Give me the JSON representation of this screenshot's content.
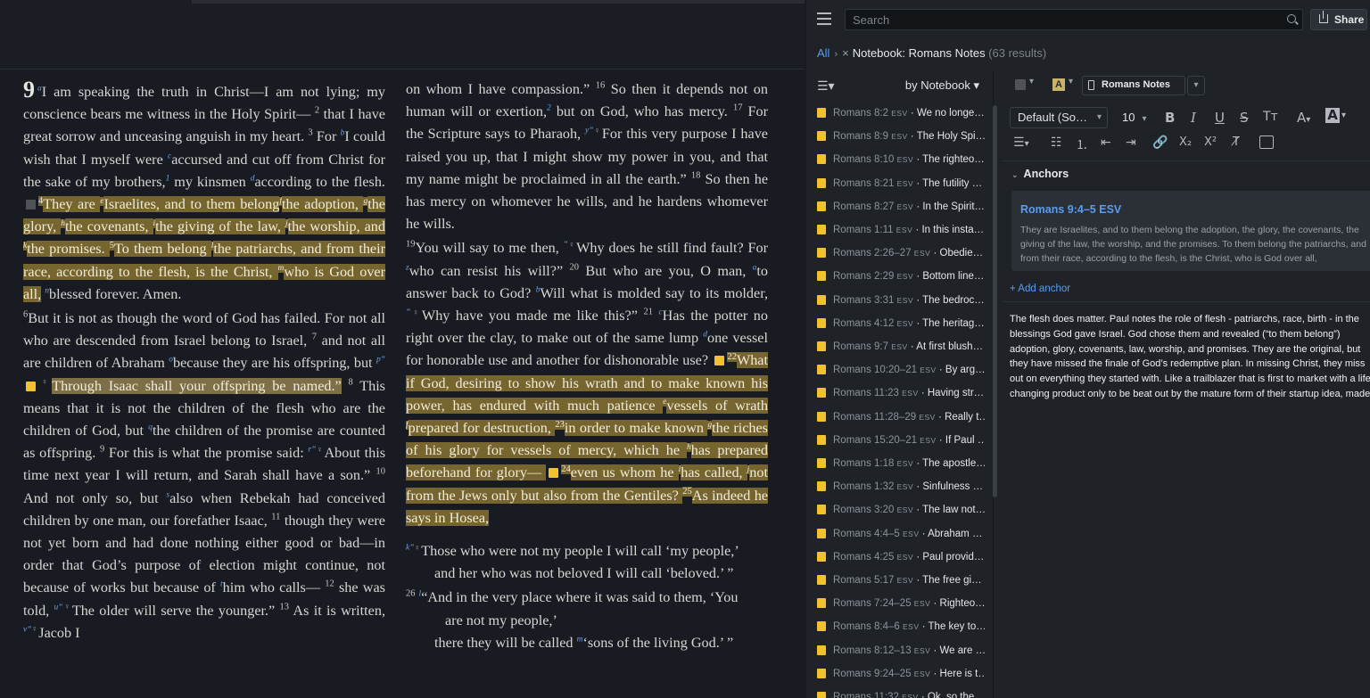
{
  "bible": {
    "col1": [
      {
        "parts": [
          {
            "t": "9",
            "c": "chap"
          },
          {
            "t": "a",
            "c": "xr"
          },
          {
            "t": "I am speaking the truth in Christ—I am not lying; my conscience bears me witness in the Holy Spirit— "
          },
          {
            "t": "2",
            "c": "vn"
          },
          {
            "t": " that I have great sorrow and unceasing anguish in my heart. "
          },
          {
            "t": "3",
            "c": "vn"
          },
          {
            "t": " For "
          },
          {
            "t": "b",
            "c": "xr"
          },
          {
            "t": "I could wish that I myself were "
          },
          {
            "t": "c",
            "c": "xr"
          },
          {
            "t": "accursed and cut off from Christ for the sake of my brothers,"
          },
          {
            "t": "1",
            "c": "xr"
          },
          {
            "t": " my kinsmen "
          },
          {
            "t": "d",
            "c": "xr"
          },
          {
            "t": "according to the flesh. "
          },
          {
            "c": "noteg"
          },
          {
            "t": "4",
            "c": "vn hl"
          },
          {
            "t": "They are ",
            "c": "hl"
          },
          {
            "t": "e",
            "c": "xr hl"
          },
          {
            "t": "Israelites, and to them belong",
            "c": "hl"
          },
          {
            "t": "f",
            "c": "xr hl"
          },
          {
            "t": "the adoption, ",
            "c": "hl"
          },
          {
            "t": "g",
            "c": "xr hl"
          },
          {
            "t": "the glory, ",
            "c": "hl"
          },
          {
            "t": "h",
            "c": "xr hl"
          },
          {
            "t": "the covenants, ",
            "c": "hl"
          },
          {
            "t": "i",
            "c": "xr hl"
          },
          {
            "t": "the giving of the law, ",
            "c": "hl"
          },
          {
            "t": "j",
            "c": "xr hl"
          },
          {
            "t": "the worship, and ",
            "c": "hl"
          },
          {
            "t": "k",
            "c": "xr hl"
          },
          {
            "t": "the promises. ",
            "c": "hl"
          },
          {
            "t": "5",
            "c": "vn hl"
          },
          {
            "t": "To them belong ",
            "c": "hl"
          },
          {
            "t": "l",
            "c": "xr hl"
          },
          {
            "t": "the patriarchs, and from their race, according to the flesh, is the Christ, ",
            "c": "hl"
          },
          {
            "t": "m",
            "c": "xr hl"
          },
          {
            "t": "who is God over all,",
            "c": "hl"
          },
          {
            "t": " "
          },
          {
            "t": "n",
            "c": "xr"
          },
          {
            "t": "blessed forever. Amen."
          }
        ]
      },
      {
        "parts": [
          {
            "t": "6",
            "c": "vn"
          },
          {
            "t": "But it is not as though the word of God has failed. For not all who are descended from Israel belong to Israel, "
          },
          {
            "t": "7",
            "c": "vn"
          },
          {
            "t": " and not all are children of Abraham "
          },
          {
            "t": "o",
            "c": "xr"
          },
          {
            "t": "because they are his offspring, but "
          },
          {
            "t": "p",
            "c": "xr"
          },
          {
            "t": "“",
            "c": "xr"
          },
          {
            "c": "note"
          },
          {
            "t": "♀",
            "c": "aud"
          },
          {
            "t": "Through Isaac shall your offspring be named.”",
            "c": "hl2"
          },
          {
            "t": " "
          },
          {
            "t": "8",
            "c": "vn"
          },
          {
            "t": " This means that it is not the children of the flesh who are the children of God, but "
          },
          {
            "t": "q",
            "c": "xr"
          },
          {
            "t": "the children of the promise are counted as offspring. "
          },
          {
            "t": "9",
            "c": "vn"
          },
          {
            "t": " For this is what the promise said: "
          },
          {
            "t": "r",
            "c": "xr"
          },
          {
            "t": "“",
            "c": "xr"
          },
          {
            "t": "♀",
            "c": "aud"
          },
          {
            "t": "About this time next year I will return, and Sarah shall have a son.” "
          },
          {
            "t": "10",
            "c": "vn"
          },
          {
            "t": " And not only so, but "
          },
          {
            "t": "s",
            "c": "xr"
          },
          {
            "t": "also when Rebekah had conceived children by one man, our forefather Isaac, "
          },
          {
            "t": "11",
            "c": "vn"
          },
          {
            "t": " though they were not yet born and had done nothing either good or bad—in order that God’s purpose of election might continue, not because of works but because of "
          },
          {
            "t": "t",
            "c": "xr"
          },
          {
            "t": "him who calls— "
          },
          {
            "t": "12",
            "c": "vn"
          },
          {
            "t": " she was told, "
          },
          {
            "t": "u",
            "c": "xr"
          },
          {
            "t": "“",
            "c": "xr"
          },
          {
            "t": "♀",
            "c": "aud"
          },
          {
            "t": "The older will serve the younger.” "
          },
          {
            "t": "13",
            "c": "vn"
          },
          {
            "t": " As it is written, "
          },
          {
            "t": "v",
            "c": "xr"
          },
          {
            "t": "“",
            "c": "xr"
          },
          {
            "t": "♀",
            "c": "aud"
          },
          {
            "t": "Jacob I"
          }
        ]
      }
    ],
    "col2": [
      {
        "parts": [
          {
            "t": "on whom I have compassion.” "
          },
          {
            "t": "16",
            "c": "vn"
          },
          {
            "t": " So then it depends not on human will or exertion,"
          },
          {
            "t": "2",
            "c": "xr"
          },
          {
            "t": " but on God, who has mercy. "
          },
          {
            "t": "17",
            "c": "vn"
          },
          {
            "t": " For the Scripture says to Pharaoh, "
          },
          {
            "t": "y",
            "c": "xr"
          },
          {
            "t": "“",
            "c": "xr"
          },
          {
            "t": "♀",
            "c": "aud"
          },
          {
            "t": "For this very purpose I have raised you up, that I might show my power in you, and that my name might be proclaimed in all the earth.” "
          },
          {
            "t": "18",
            "c": "vn"
          },
          {
            "t": " So then he has mercy on whomever he wills, and he hardens whomever he wills."
          }
        ]
      },
      {
        "parts": [
          {
            "t": "19",
            "c": "vn"
          },
          {
            "t": "You will say to me then, "
          },
          {
            "t": "“",
            "c": "xr"
          },
          {
            "t": "♀",
            "c": "aud"
          },
          {
            "t": "Why does he still find fault? For "
          },
          {
            "t": "z",
            "c": "xr"
          },
          {
            "t": "who can resist his will?” "
          },
          {
            "t": "20",
            "c": "vn"
          },
          {
            "t": " But who are you, O man, "
          },
          {
            "t": "a",
            "c": "xr"
          },
          {
            "t": "to answer back to God? "
          },
          {
            "t": "b",
            "c": "xr"
          },
          {
            "t": "Will what is molded say to its molder, "
          },
          {
            "t": "“",
            "c": "xr"
          },
          {
            "t": "♀",
            "c": "aud"
          },
          {
            "t": "Why have you made me like this?” "
          },
          {
            "t": "21",
            "c": "vn"
          },
          {
            "t": " "
          },
          {
            "t": "c",
            "c": "xr"
          },
          {
            "t": "Has the potter no right over the clay, to make out of the same lump "
          },
          {
            "t": "d",
            "c": "xr"
          },
          {
            "t": "one vessel for honorable use and another for dishonorable use? "
          },
          {
            "c": "note"
          },
          {
            "t": "22",
            "c": "vn hl"
          },
          {
            "t": "What if God, desiring to show his wrath and to make known his power, has endured with much patience ",
            "c": "hl"
          },
          {
            "t": "e",
            "c": "xr hl"
          },
          {
            "t": "vessels of wrath ",
            "c": "hl"
          },
          {
            "t": "f",
            "c": "xr hl"
          },
          {
            "t": "prepared for destruction, ",
            "c": "hl"
          },
          {
            "t": "23",
            "c": "vn hl"
          },
          {
            "t": "in order to make known ",
            "c": "hl"
          },
          {
            "t": "g",
            "c": "xr hl"
          },
          {
            "t": "the riches of his glory for vessels of mercy, which he ",
            "c": "hl"
          },
          {
            "t": "h",
            "c": "xr hl"
          },
          {
            "t": "has prepared beforehand for glory— ",
            "c": "hl"
          },
          {
            "c": "note"
          },
          {
            "t": "24",
            "c": "vn hl"
          },
          {
            "t": "even us whom he ",
            "c": "hl"
          },
          {
            "t": "i",
            "c": "xr hl"
          },
          {
            "t": "has called, ",
            "c": "hl"
          },
          {
            "t": "j",
            "c": "xr hl"
          },
          {
            "t": "not from the Jews only but also from the Gentiles? ",
            "c": "hl"
          },
          {
            "t": "25",
            "c": "vn hl"
          },
          {
            "t": "As indeed he says in Hosea,",
            "c": "hl"
          }
        ]
      }
    ],
    "col2_poem": [
      {
        "c": "poem",
        "parts": [
          {
            "t": "k",
            "c": "xr"
          },
          {
            "t": "“",
            "c": "xr"
          },
          {
            "t": "♀",
            "c": "aud"
          },
          {
            "t": "Those who were not my people I will call ‘my people,’"
          }
        ]
      },
      {
        "c": "poem2",
        "parts": [
          {
            "t": "and her who was not beloved I will call ‘beloved.’ ”"
          }
        ]
      },
      {
        "c": "poem",
        "parts": [
          {
            "t": "26",
            "c": "vn"
          },
          {
            "t": " "
          },
          {
            "t": "l",
            "c": "xr"
          },
          {
            "t": "“And in the very place where it was said to them, ‘You"
          }
        ]
      },
      {
        "c": "poem3",
        "parts": [
          {
            "t": "are not my people,’"
          }
        ]
      },
      {
        "c": "poem2",
        "parts": [
          {
            "t": "there they will be called "
          },
          {
            "t": "m",
            "c": "xr"
          },
          {
            "t": "‘sons of the living God.’ ”"
          }
        ]
      }
    ]
  },
  "topbar": {
    "search_placeholder": "Search",
    "share_label": "Share"
  },
  "breadcrumb": {
    "all": "All",
    "chev": "›",
    "close": "×",
    "title": "Notebook: Romans Notes",
    "count": "(63 results)"
  },
  "list": {
    "view_icon": "☰▾",
    "sort_label": "by Notebook ▾",
    "notes": [
      {
        "ref": "Romans 8:2",
        "esv": "ESV",
        "text": "We no longe…"
      },
      {
        "ref": "Romans 8:9",
        "esv": "ESV",
        "text": "The Holy Spi…"
      },
      {
        "ref": "Romans 8:10",
        "esv": "ESV",
        "text": "The righteo…"
      },
      {
        "ref": "Romans 8:21",
        "esv": "ESV",
        "text": "The futility …"
      },
      {
        "ref": "Romans 8:27",
        "esv": "ESV",
        "text": "In the Spirit…"
      },
      {
        "ref": "Romans 1:11",
        "esv": "ESV",
        "text": "In this insta…"
      },
      {
        "ref": "Romans 2:26–27",
        "esv": "ESV",
        "text": "Obedie…"
      },
      {
        "ref": "Romans 2:29",
        "esv": "ESV",
        "text": "Bottom line…"
      },
      {
        "ref": "Romans 3:31",
        "esv": "ESV",
        "text": "The bedroc…"
      },
      {
        "ref": "Romans 4:12",
        "esv": "ESV",
        "text": "The heritag…"
      },
      {
        "ref": "Romans 9:7",
        "esv": "ESV",
        "text": "At first blush…"
      },
      {
        "ref": "Romans 10:20–21",
        "esv": "ESV",
        "text": "By arg…"
      },
      {
        "ref": "Romans 11:23",
        "esv": "ESV",
        "text": "Having str…"
      },
      {
        "ref": "Romans 11:28–29",
        "esv": "ESV",
        "text": "Really t…"
      },
      {
        "ref": "Romans 15:20–21",
        "esv": "ESV",
        "text": "If Paul …"
      },
      {
        "ref": "Romans 1:18",
        "esv": "ESV",
        "text": "The apostle…"
      },
      {
        "ref": "Romans 1:32",
        "esv": "ESV",
        "text": "Sinfulness …"
      },
      {
        "ref": "Romans 3:20",
        "esv": "ESV",
        "text": "The law not…"
      },
      {
        "ref": "Romans 4:4–5",
        "esv": "ESV",
        "text": "Abraham …"
      },
      {
        "ref": "Romans 4:25",
        "esv": "ESV",
        "text": "Paul provid…"
      },
      {
        "ref": "Romans 5:17",
        "esv": "ESV",
        "text": "The free gi…"
      },
      {
        "ref": "Romans 7:24–25",
        "esv": "ESV",
        "text": "Righteo…"
      },
      {
        "ref": "Romans 8:4–6",
        "esv": "ESV",
        "text": "The key to…"
      },
      {
        "ref": "Romans 8:12–13",
        "esv": "ESV",
        "text": "We are …"
      },
      {
        "ref": "Romans 9:24–25",
        "esv": "ESV",
        "text": "Here is t…"
      },
      {
        "ref": "Romans 11:32",
        "esv": "ESV",
        "text": "Ok, so the…"
      }
    ]
  },
  "editor": {
    "notebook_label": "Romans Notes",
    "font_family": "Default (So…",
    "font_size": "10",
    "anchors_heading": "Anchors",
    "anchor_ref": "Romans 9:4–5 ESV",
    "anchor_text": "They are Israelites, and to them belong the adoption, the glory, the covenants, the giving of the law, the worship, and the promises. To them belong the patriarchs, and from their race, according to the flesh, is the Christ, who is God over all,",
    "add_anchor": "+ Add anchor",
    "note_text": "The flesh does matter. Paul notes the role of flesh - patriarchs, race, birth - in the blessings God gave Israel. God chose them and revealed (“to them belong”) adoption, glory, covenants, law, worship, and promises. They are the original, but they have missed the finale of God’s redemptive plan. In missing Christ, they miss out on everything they started with. Like a trailblazer that is first to market with a life changing product only to be beat out by the mature form of their startup idea, made"
  },
  "colors": {
    "highlight": "#76652f",
    "note_yellow": "#f2c12e",
    "link_blue": "#5b9bf0"
  }
}
